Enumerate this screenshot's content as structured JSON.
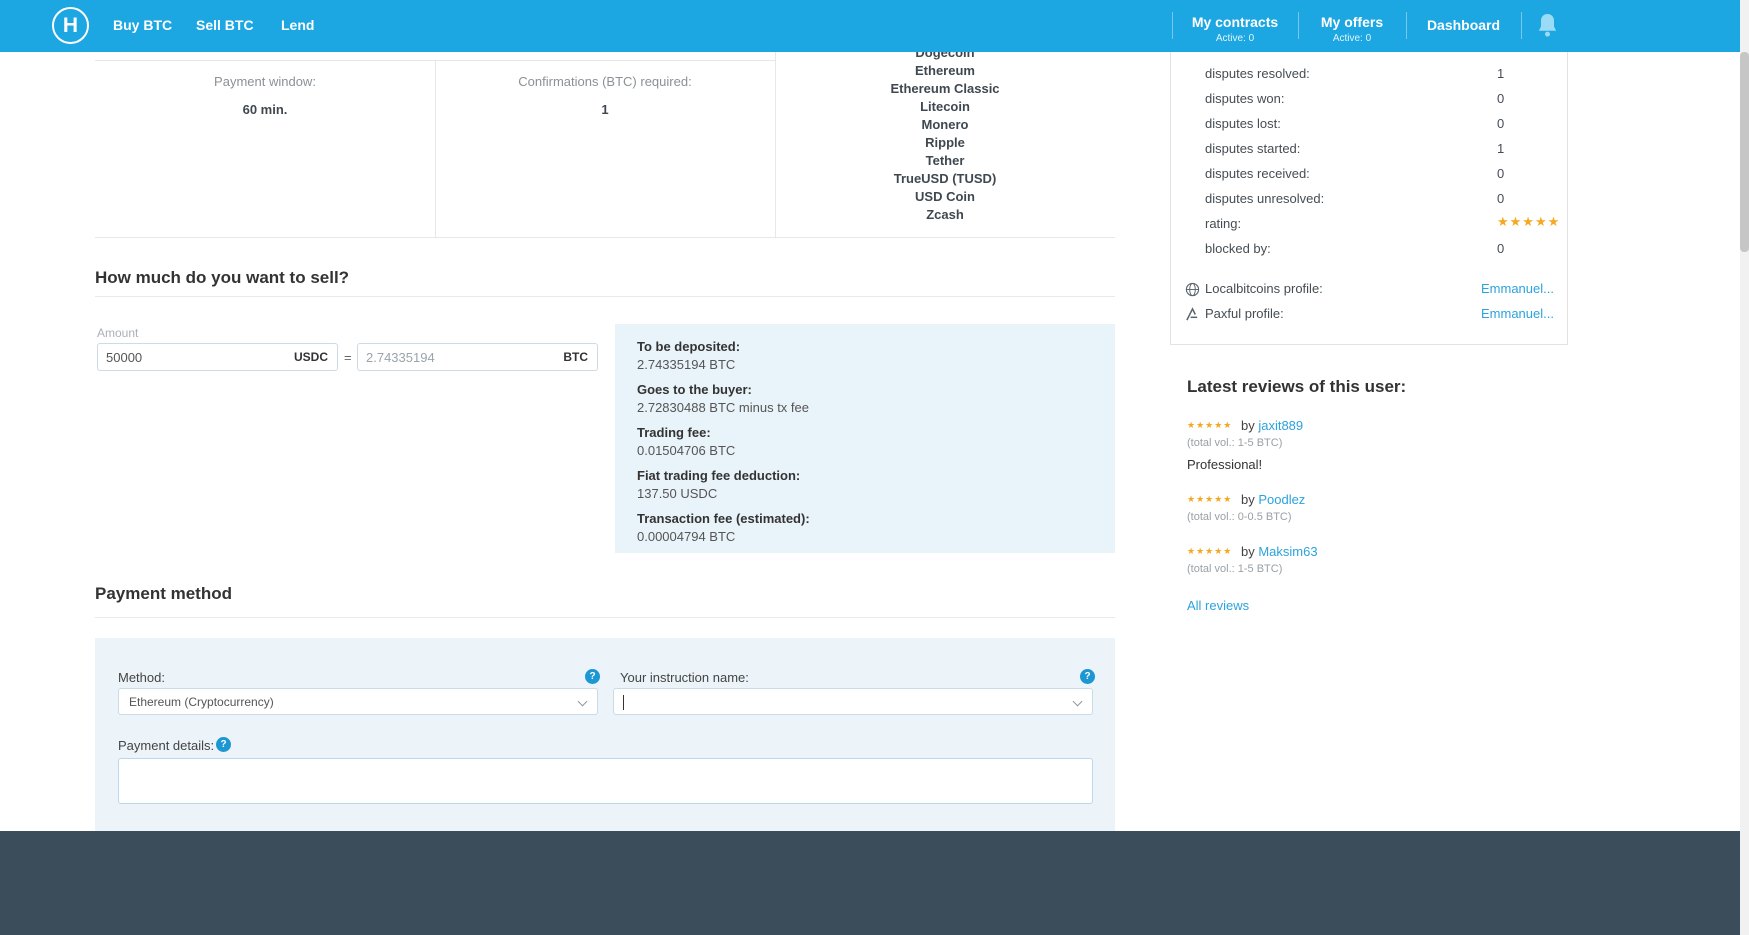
{
  "header": {
    "logo_letter": "H",
    "nav": [
      {
        "label": "Buy BTC"
      },
      {
        "label": "Sell BTC"
      },
      {
        "label": "Lend"
      }
    ],
    "my_contracts": {
      "label": "My contracts",
      "sub": "Active: 0"
    },
    "my_offers": {
      "label": "My offers",
      "sub": "Active: 0"
    },
    "dashboard": {
      "label": "Dashboard"
    }
  },
  "offer_table": {
    "payment_window": {
      "label": "Payment window:",
      "value": "60 min."
    },
    "confirmations": {
      "label": "Confirmations (BTC) required:",
      "value": "1"
    },
    "altcoins": [
      "Dogecoin",
      "Ethereum",
      "Ethereum Classic",
      "Litecoin",
      "Monero",
      "Ripple",
      "Tether",
      "TrueUSD (TUSD)",
      "USD Coin",
      "Zcash"
    ]
  },
  "sell": {
    "title": "How much do you want to sell?",
    "amount_label": "Amount",
    "amount_value": "50000",
    "amount_currency": "USDC",
    "equals": "=",
    "converted_value": "2.74335194",
    "converted_currency": "BTC",
    "summary": [
      {
        "label": "To be deposited:",
        "value": "2.74335194 BTC"
      },
      {
        "label": "Goes to the buyer:",
        "value": "2.72830488 BTC minus tx fee"
      },
      {
        "label": "Trading fee:",
        "value": "0.01504706 BTC"
      },
      {
        "label": "Fiat trading fee deduction:",
        "value": "137.50 USDC"
      },
      {
        "label": "Transaction fee (estimated):",
        "value": "0.00004794 BTC"
      }
    ]
  },
  "payment": {
    "title": "Payment method",
    "method_label": "Method:",
    "method_value": "Ethereum (Cryptocurrency)",
    "instruction_label": "Your instruction name:",
    "details_label": "Payment details:",
    "help_glyph": "?"
  },
  "profile": {
    "stats": [
      {
        "label": "disputes resolved:",
        "value": "1"
      },
      {
        "label": "disputes won:",
        "value": "0"
      },
      {
        "label": "disputes lost:",
        "value": "0"
      },
      {
        "label": "disputes started:",
        "value": "1"
      },
      {
        "label": "disputes received:",
        "value": "0"
      },
      {
        "label": "disputes unresolved:",
        "value": "0"
      }
    ],
    "rating_label": "rating:",
    "rating_stars": "★★★★★",
    "blocked_label": "blocked by:",
    "blocked_value": "0",
    "localbitcoins": {
      "label": "Localbitcoins profile:",
      "value": "Emmanuel..."
    },
    "paxful": {
      "label": "Paxful profile:",
      "value": "Emmanuel..."
    }
  },
  "reviews": {
    "title": "Latest reviews of this user:",
    "by": "by",
    "stars": "★★★★★",
    "items": [
      {
        "user": "jaxit889",
        "volume": "(total vol.: 1-5 BTC)",
        "comment": "Professional!"
      },
      {
        "user": "Poodlez",
        "volume": "(total vol.: 0-0.5 BTC)",
        "comment": ""
      },
      {
        "user": "Maksim63",
        "volume": "(total vol.: 1-5 BTC)",
        "comment": ""
      }
    ],
    "all_reviews": "All reviews"
  }
}
